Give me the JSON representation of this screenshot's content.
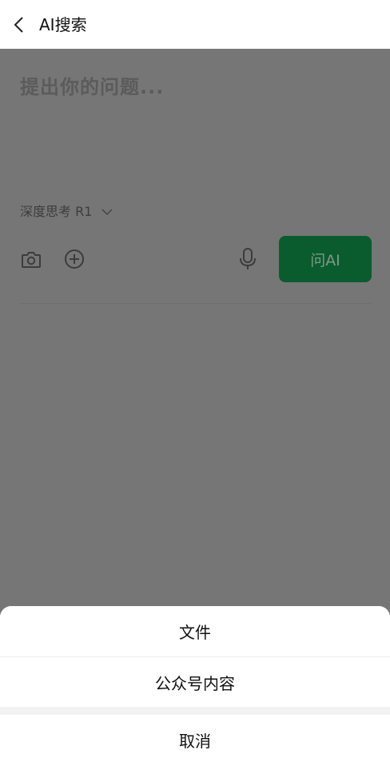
{
  "header": {
    "title": "AI搜索",
    "back_icon": "chevron-left-icon"
  },
  "composer": {
    "placeholder": "提出你的问题...",
    "model_label": "深度思考 R1",
    "ask_button_label": "问AI",
    "icons": [
      "camera-icon",
      "plus-circle-icon",
      "microphone-icon",
      "chevron-down-icon"
    ],
    "accent_color": "#0a5c2e"
  },
  "action_sheet": {
    "items": [
      "文件",
      "公众号内容"
    ],
    "cancel_label": "取消"
  }
}
